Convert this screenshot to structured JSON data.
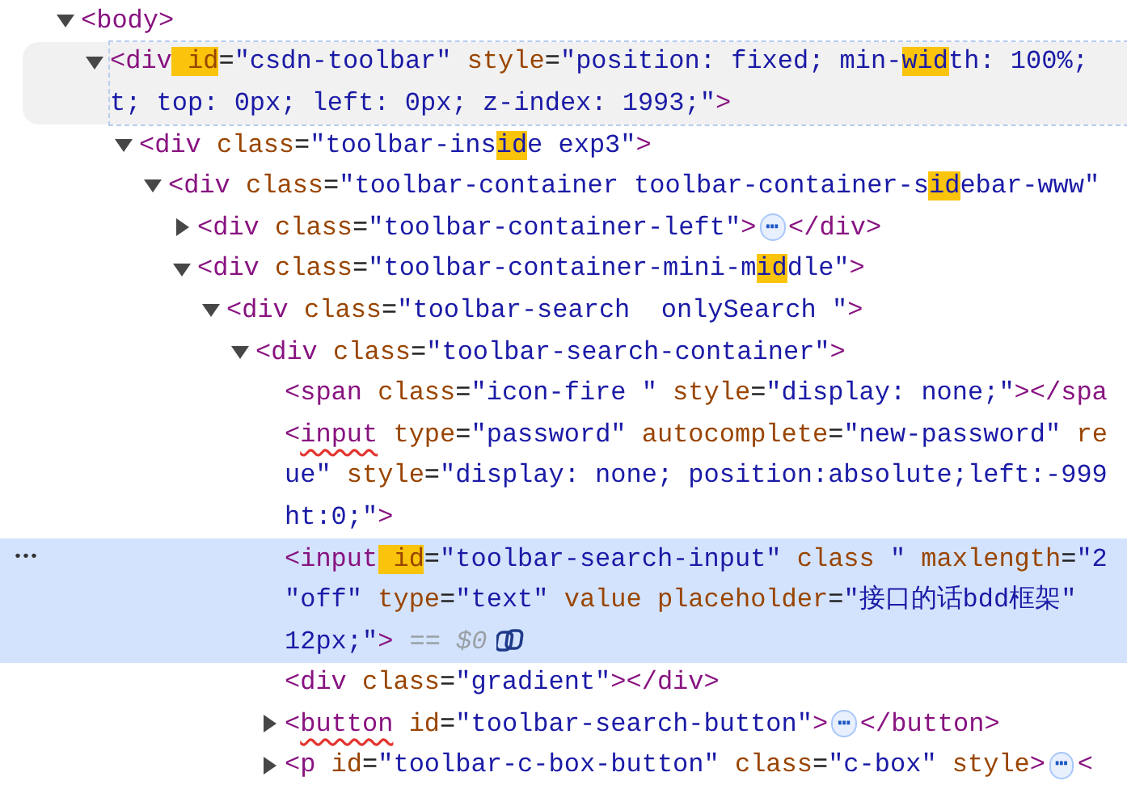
{
  "nodes": [
    {
      "kind": "parent",
      "expanded": true,
      "selected": false,
      "hovered": false,
      "lines": [
        [
          {
            "kind": "code",
            "tokens": [
              {
                "kind": "tag",
                "text": "<body>"
              }
            ]
          }
        ]
      ],
      "children": [
        {
          "kind": "parent",
          "expanded": true,
          "selected": false,
          "hovered": true,
          "lines": [
            [
              {
                "kind": "code",
                "tokens": [
                  {
                    "kind": "tag",
                    "text": "<div"
                  },
                  {
                    "kind": "attr-match",
                    "text": " id"
                  },
                  {
                    "kind": "plain",
                    "text": "="
                  },
                  {
                    "kind": "value",
                    "text": "\"csdn-toolbar\""
                  },
                  {
                    "kind": "attr",
                    "text": " style"
                  },
                  {
                    "kind": "plain",
                    "text": "="
                  },
                  {
                    "kind": "value",
                    "text": "\"position: fixed; min-"
                  },
                  {
                    "kind": "value-match",
                    "text": "wid"
                  },
                  {
                    "kind": "value",
                    "text": "th: 100%;"
                  }
                ]
              }
            ],
            [
              {
                "kind": "code",
                "tokens": [
                  {
                    "kind": "value",
                    "text": "t; top: 0px; left: 0px; z-index: 1993;\""
                  },
                  {
                    "kind": "tag",
                    "text": ">"
                  }
                ]
              }
            ]
          ],
          "children": [
            {
              "kind": "parent",
              "expanded": true,
              "selected": false,
              "hovered": false,
              "lines": [
                [
                  {
                    "kind": "code",
                    "tokens": [
                      {
                        "kind": "tag",
                        "text": "<div"
                      },
                      {
                        "kind": "attr",
                        "text": " class"
                      },
                      {
                        "kind": "plain",
                        "text": "="
                      },
                      {
                        "kind": "value",
                        "text": "\"toolbar-ins"
                      },
                      {
                        "kind": "value-match",
                        "text": "id"
                      },
                      {
                        "kind": "value",
                        "text": "e exp3\""
                      },
                      {
                        "kind": "tag",
                        "text": ">"
                      }
                    ]
                  }
                ]
              ],
              "children": [
                {
                  "kind": "parent",
                  "expanded": true,
                  "selected": false,
                  "hovered": false,
                  "lines": [
                    [
                      {
                        "kind": "code",
                        "tokens": [
                          {
                            "kind": "tag",
                            "text": "<div"
                          },
                          {
                            "kind": "attr",
                            "text": " class"
                          },
                          {
                            "kind": "plain",
                            "text": "="
                          },
                          {
                            "kind": "value",
                            "text": "\"toolbar-container toolbar-container-s"
                          },
                          {
                            "kind": "value-match",
                            "text": "id"
                          },
                          {
                            "kind": "value",
                            "text": "ebar-www\""
                          }
                        ]
                      }
                    ]
                  ],
                  "children": [
                    {
                      "kind": "parent",
                      "expanded": false,
                      "selected": false,
                      "hovered": false,
                      "lines": [
                        [
                          {
                            "kind": "code",
                            "tokens": [
                              {
                                "kind": "tag",
                                "text": "<div"
                              },
                              {
                                "kind": "attr",
                                "text": " class"
                              },
                              {
                                "kind": "plain",
                                "text": "="
                              },
                              {
                                "kind": "value",
                                "text": "\"toolbar-container-left\""
                              },
                              {
                                "kind": "tag",
                                "text": ">"
                              }
                            ]
                          },
                          {
                            "kind": "ellipsis",
                            "text": "⋯"
                          },
                          {
                            "kind": "code",
                            "tokens": [
                              {
                                "kind": "tag",
                                "text": "</div>"
                              }
                            ]
                          }
                        ]
                      ]
                    },
                    {
                      "kind": "parent",
                      "expanded": true,
                      "selected": false,
                      "hovered": false,
                      "lines": [
                        [
                          {
                            "kind": "code",
                            "tokens": [
                              {
                                "kind": "tag",
                                "text": "<div"
                              },
                              {
                                "kind": "attr",
                                "text": " class"
                              },
                              {
                                "kind": "plain",
                                "text": "="
                              },
                              {
                                "kind": "value",
                                "text": "\"toolbar-container-mini-m"
                              },
                              {
                                "kind": "value-match",
                                "text": "id"
                              },
                              {
                                "kind": "value",
                                "text": "dle\""
                              },
                              {
                                "kind": "tag",
                                "text": ">"
                              }
                            ]
                          }
                        ]
                      ],
                      "children": [
                        {
                          "kind": "parent",
                          "expanded": true,
                          "selected": false,
                          "hovered": false,
                          "lines": [
                            [
                              {
                                "kind": "code",
                                "tokens": [
                                  {
                                    "kind": "tag",
                                    "text": "<div"
                                  },
                                  {
                                    "kind": "attr",
                                    "text": " class"
                                  },
                                  {
                                    "kind": "plain",
                                    "text": "="
                                  },
                                  {
                                    "kind": "value",
                                    "text": "\"toolbar-search  onlySearch \""
                                  },
                                  {
                                    "kind": "tag",
                                    "text": ">"
                                  }
                                ]
                              }
                            ]
                          ],
                          "children": [
                            {
                              "kind": "parent",
                              "expanded": true,
                              "selected": false,
                              "hovered": false,
                              "lines": [
                                [
                                  {
                                    "kind": "code",
                                    "tokens": [
                                      {
                                        "kind": "tag",
                                        "text": "<div"
                                      },
                                      {
                                        "kind": "attr",
                                        "text": " class"
                                      },
                                      {
                                        "kind": "plain",
                                        "text": "="
                                      },
                                      {
                                        "kind": "value",
                                        "text": "\"toolbar-search-container\""
                                      },
                                      {
                                        "kind": "tag",
                                        "text": ">"
                                      }
                                    ]
                                  }
                                ]
                              ],
                              "children": [
                                {
                                  "kind": "leaf",
                                  "selected": false,
                                  "hovered": false,
                                  "lines": [
                                    [
                                      {
                                        "kind": "code",
                                        "tokens": [
                                          {
                                            "kind": "tag",
                                            "text": "<span"
                                          },
                                          {
                                            "kind": "attr",
                                            "text": " class"
                                          },
                                          {
                                            "kind": "plain",
                                            "text": "="
                                          },
                                          {
                                            "kind": "value",
                                            "text": "\"icon-fire \""
                                          },
                                          {
                                            "kind": "attr",
                                            "text": " style"
                                          },
                                          {
                                            "kind": "plain",
                                            "text": "="
                                          },
                                          {
                                            "kind": "value",
                                            "text": "\"display: none;\""
                                          },
                                          {
                                            "kind": "tag",
                                            "text": "></spa"
                                          }
                                        ]
                                      }
                                    ]
                                  ]
                                },
                                {
                                  "kind": "leaf",
                                  "selected": false,
                                  "hovered": false,
                                  "lines": [
                                    [
                                      {
                                        "kind": "code",
                                        "tokens": [
                                          {
                                            "kind": "tag",
                                            "text": "<"
                                          },
                                          {
                                            "kind": "tag-warn",
                                            "text": "input"
                                          },
                                          {
                                            "kind": "attr",
                                            "text": " type"
                                          },
                                          {
                                            "kind": "plain",
                                            "text": "="
                                          },
                                          {
                                            "kind": "value",
                                            "text": "\"password\""
                                          },
                                          {
                                            "kind": "attr",
                                            "text": " autocomplete"
                                          },
                                          {
                                            "kind": "plain",
                                            "text": "="
                                          },
                                          {
                                            "kind": "value",
                                            "text": "\"new-password\""
                                          },
                                          {
                                            "kind": "attr",
                                            "text": " re"
                                          }
                                        ]
                                      }
                                    ],
                                    [
                                      {
                                        "kind": "code",
                                        "tokens": [
                                          {
                                            "kind": "value",
                                            "text": "ue\""
                                          },
                                          {
                                            "kind": "attr",
                                            "text": " style"
                                          },
                                          {
                                            "kind": "plain",
                                            "text": "="
                                          },
                                          {
                                            "kind": "value",
                                            "text": "\"display: none; position:absolute;left:-999"
                                          }
                                        ]
                                      }
                                    ],
                                    [
                                      {
                                        "kind": "code",
                                        "tokens": [
                                          {
                                            "kind": "value",
                                            "text": "ht:0;\""
                                          },
                                          {
                                            "kind": "tag",
                                            "text": ">"
                                          }
                                        ]
                                      }
                                    ]
                                  ]
                                },
                                {
                                  "kind": "leaf",
                                  "selected": true,
                                  "hovered": false,
                                  "gutter": "•••",
                                  "lines": [
                                    [
                                      {
                                        "kind": "code",
                                        "tokens": [
                                          {
                                            "kind": "tag",
                                            "text": "<input"
                                          },
                                          {
                                            "kind": "attr-match",
                                            "text": " id"
                                          },
                                          {
                                            "kind": "plain",
                                            "text": "="
                                          },
                                          {
                                            "kind": "value",
                                            "text": "\"toolbar-search-input\""
                                          },
                                          {
                                            "kind": "attr",
                                            "text": " class"
                                          },
                                          {
                                            "kind": "value",
                                            "text": " \""
                                          },
                                          {
                                            "kind": "attr",
                                            "text": " maxlength"
                                          },
                                          {
                                            "kind": "plain",
                                            "text": "="
                                          },
                                          {
                                            "kind": "value",
                                            "text": "\"2"
                                          }
                                        ]
                                      }
                                    ],
                                    [
                                      {
                                        "kind": "code",
                                        "tokens": [
                                          {
                                            "kind": "value",
                                            "text": "\"off\""
                                          },
                                          {
                                            "kind": "attr",
                                            "text": " type"
                                          },
                                          {
                                            "kind": "plain",
                                            "text": "="
                                          },
                                          {
                                            "kind": "value",
                                            "text": "\"text\""
                                          },
                                          {
                                            "kind": "attr",
                                            "text": " value placeholder"
                                          },
                                          {
                                            "kind": "plain",
                                            "text": "="
                                          },
                                          {
                                            "kind": "value",
                                            "text": "\"接口的话bdd框架\""
                                          }
                                        ]
                                      }
                                    ],
                                    [
                                      {
                                        "kind": "code",
                                        "tokens": [
                                          {
                                            "kind": "value",
                                            "text": "12px;\""
                                          },
                                          {
                                            "kind": "tag",
                                            "text": ">"
                                          }
                                        ]
                                      },
                                      {
                                        "kind": "console",
                                        "text": "== $0"
                                      }
                                    ]
                                  ]
                                },
                                {
                                  "kind": "leaf",
                                  "selected": false,
                                  "hovered": false,
                                  "lines": [
                                    [
                                      {
                                        "kind": "code",
                                        "tokens": [
                                          {
                                            "kind": "tag",
                                            "text": "<div"
                                          },
                                          {
                                            "kind": "attr",
                                            "text": " class"
                                          },
                                          {
                                            "kind": "plain",
                                            "text": "="
                                          },
                                          {
                                            "kind": "value",
                                            "text": "\"gradient\""
                                          },
                                          {
                                            "kind": "tag",
                                            "text": "></div>"
                                          }
                                        ]
                                      }
                                    ]
                                  ]
                                },
                                {
                                  "kind": "parent",
                                  "expanded": false,
                                  "selected": false,
                                  "hovered": false,
                                  "lines": [
                                    [
                                      {
                                        "kind": "code",
                                        "tokens": [
                                          {
                                            "kind": "tag",
                                            "text": "<"
                                          },
                                          {
                                            "kind": "tag-warn",
                                            "text": "button"
                                          },
                                          {
                                            "kind": "attr",
                                            "text": " id"
                                          },
                                          {
                                            "kind": "plain",
                                            "text": "="
                                          },
                                          {
                                            "kind": "value",
                                            "text": "\"toolbar-search-button\""
                                          },
                                          {
                                            "kind": "tag",
                                            "text": ">"
                                          }
                                        ]
                                      },
                                      {
                                        "kind": "ellipsis",
                                        "text": "⋯"
                                      },
                                      {
                                        "kind": "code",
                                        "tokens": [
                                          {
                                            "kind": "tag",
                                            "text": "</button>"
                                          }
                                        ]
                                      }
                                    ]
                                  ]
                                },
                                {
                                  "kind": "parent",
                                  "expanded": false,
                                  "selected": false,
                                  "hovered": false,
                                  "lines": [
                                    [
                                      {
                                        "kind": "code",
                                        "tokens": [
                                          {
                                            "kind": "tag",
                                            "text": "<p"
                                          },
                                          {
                                            "kind": "attr",
                                            "text": " id"
                                          },
                                          {
                                            "kind": "plain",
                                            "text": "="
                                          },
                                          {
                                            "kind": "value",
                                            "text": "\"toolbar-c-box-button\""
                                          },
                                          {
                                            "kind": "attr",
                                            "text": " class"
                                          },
                                          {
                                            "kind": "plain",
                                            "text": "="
                                          },
                                          {
                                            "kind": "value",
                                            "text": "\"c-box\""
                                          },
                                          {
                                            "kind": "attr",
                                            "text": " style"
                                          },
                                          {
                                            "kind": "tag",
                                            "text": ">"
                                          }
                                        ]
                                      },
                                      {
                                        "kind": "ellipsis",
                                        "text": "⋯"
                                      },
                                      {
                                        "kind": "code",
                                        "tokens": [
                                          {
                                            "kind": "tag",
                                            "text": "<"
                                          }
                                        ]
                                      }
                                    ]
                                  ]
                                }
                              ]
                            }
                          ]
                        }
                      ]
                    }
                  ]
                }
              ]
            }
          ]
        }
      ]
    }
  ]
}
